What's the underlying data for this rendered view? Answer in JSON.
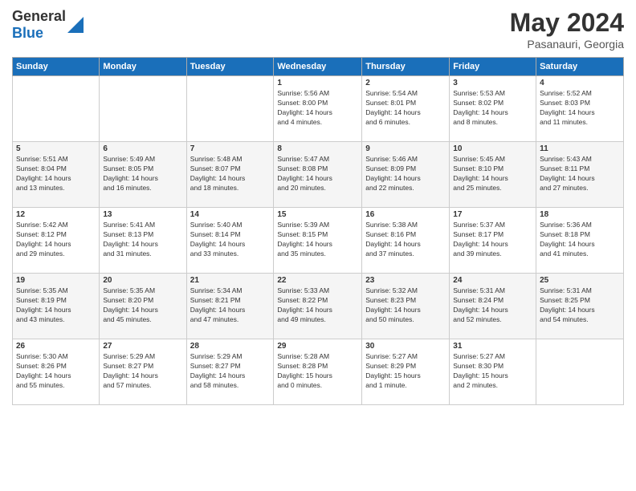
{
  "header": {
    "logo": {
      "general": "General",
      "blue": "Blue"
    },
    "title": "May 2024",
    "location": "Pasanauri, Georgia"
  },
  "weekdays": [
    "Sunday",
    "Monday",
    "Tuesday",
    "Wednesday",
    "Thursday",
    "Friday",
    "Saturday"
  ],
  "weeks": [
    [
      {
        "day": "",
        "info": ""
      },
      {
        "day": "",
        "info": ""
      },
      {
        "day": "",
        "info": ""
      },
      {
        "day": "1",
        "info": "Sunrise: 5:56 AM\nSunset: 8:00 PM\nDaylight: 14 hours\nand 4 minutes."
      },
      {
        "day": "2",
        "info": "Sunrise: 5:54 AM\nSunset: 8:01 PM\nDaylight: 14 hours\nand 6 minutes."
      },
      {
        "day": "3",
        "info": "Sunrise: 5:53 AM\nSunset: 8:02 PM\nDaylight: 14 hours\nand 8 minutes."
      },
      {
        "day": "4",
        "info": "Sunrise: 5:52 AM\nSunset: 8:03 PM\nDaylight: 14 hours\nand 11 minutes."
      }
    ],
    [
      {
        "day": "5",
        "info": "Sunrise: 5:51 AM\nSunset: 8:04 PM\nDaylight: 14 hours\nand 13 minutes."
      },
      {
        "day": "6",
        "info": "Sunrise: 5:49 AM\nSunset: 8:05 PM\nDaylight: 14 hours\nand 16 minutes."
      },
      {
        "day": "7",
        "info": "Sunrise: 5:48 AM\nSunset: 8:07 PM\nDaylight: 14 hours\nand 18 minutes."
      },
      {
        "day": "8",
        "info": "Sunrise: 5:47 AM\nSunset: 8:08 PM\nDaylight: 14 hours\nand 20 minutes."
      },
      {
        "day": "9",
        "info": "Sunrise: 5:46 AM\nSunset: 8:09 PM\nDaylight: 14 hours\nand 22 minutes."
      },
      {
        "day": "10",
        "info": "Sunrise: 5:45 AM\nSunset: 8:10 PM\nDaylight: 14 hours\nand 25 minutes."
      },
      {
        "day": "11",
        "info": "Sunrise: 5:43 AM\nSunset: 8:11 PM\nDaylight: 14 hours\nand 27 minutes."
      }
    ],
    [
      {
        "day": "12",
        "info": "Sunrise: 5:42 AM\nSunset: 8:12 PM\nDaylight: 14 hours\nand 29 minutes."
      },
      {
        "day": "13",
        "info": "Sunrise: 5:41 AM\nSunset: 8:13 PM\nDaylight: 14 hours\nand 31 minutes."
      },
      {
        "day": "14",
        "info": "Sunrise: 5:40 AM\nSunset: 8:14 PM\nDaylight: 14 hours\nand 33 minutes."
      },
      {
        "day": "15",
        "info": "Sunrise: 5:39 AM\nSunset: 8:15 PM\nDaylight: 14 hours\nand 35 minutes."
      },
      {
        "day": "16",
        "info": "Sunrise: 5:38 AM\nSunset: 8:16 PM\nDaylight: 14 hours\nand 37 minutes."
      },
      {
        "day": "17",
        "info": "Sunrise: 5:37 AM\nSunset: 8:17 PM\nDaylight: 14 hours\nand 39 minutes."
      },
      {
        "day": "18",
        "info": "Sunrise: 5:36 AM\nSunset: 8:18 PM\nDaylight: 14 hours\nand 41 minutes."
      }
    ],
    [
      {
        "day": "19",
        "info": "Sunrise: 5:35 AM\nSunset: 8:19 PM\nDaylight: 14 hours\nand 43 minutes."
      },
      {
        "day": "20",
        "info": "Sunrise: 5:35 AM\nSunset: 8:20 PM\nDaylight: 14 hours\nand 45 minutes."
      },
      {
        "day": "21",
        "info": "Sunrise: 5:34 AM\nSunset: 8:21 PM\nDaylight: 14 hours\nand 47 minutes."
      },
      {
        "day": "22",
        "info": "Sunrise: 5:33 AM\nSunset: 8:22 PM\nDaylight: 14 hours\nand 49 minutes."
      },
      {
        "day": "23",
        "info": "Sunrise: 5:32 AM\nSunset: 8:23 PM\nDaylight: 14 hours\nand 50 minutes."
      },
      {
        "day": "24",
        "info": "Sunrise: 5:31 AM\nSunset: 8:24 PM\nDaylight: 14 hours\nand 52 minutes."
      },
      {
        "day": "25",
        "info": "Sunrise: 5:31 AM\nSunset: 8:25 PM\nDaylight: 14 hours\nand 54 minutes."
      }
    ],
    [
      {
        "day": "26",
        "info": "Sunrise: 5:30 AM\nSunset: 8:26 PM\nDaylight: 14 hours\nand 55 minutes."
      },
      {
        "day": "27",
        "info": "Sunrise: 5:29 AM\nSunset: 8:27 PM\nDaylight: 14 hours\nand 57 minutes."
      },
      {
        "day": "28",
        "info": "Sunrise: 5:29 AM\nSunset: 8:27 PM\nDaylight: 14 hours\nand 58 minutes."
      },
      {
        "day": "29",
        "info": "Sunrise: 5:28 AM\nSunset: 8:28 PM\nDaylight: 15 hours\nand 0 minutes."
      },
      {
        "day": "30",
        "info": "Sunrise: 5:27 AM\nSunset: 8:29 PM\nDaylight: 15 hours\nand 1 minute."
      },
      {
        "day": "31",
        "info": "Sunrise: 5:27 AM\nSunset: 8:30 PM\nDaylight: 15 hours\nand 2 minutes."
      },
      {
        "day": "",
        "info": ""
      }
    ]
  ]
}
